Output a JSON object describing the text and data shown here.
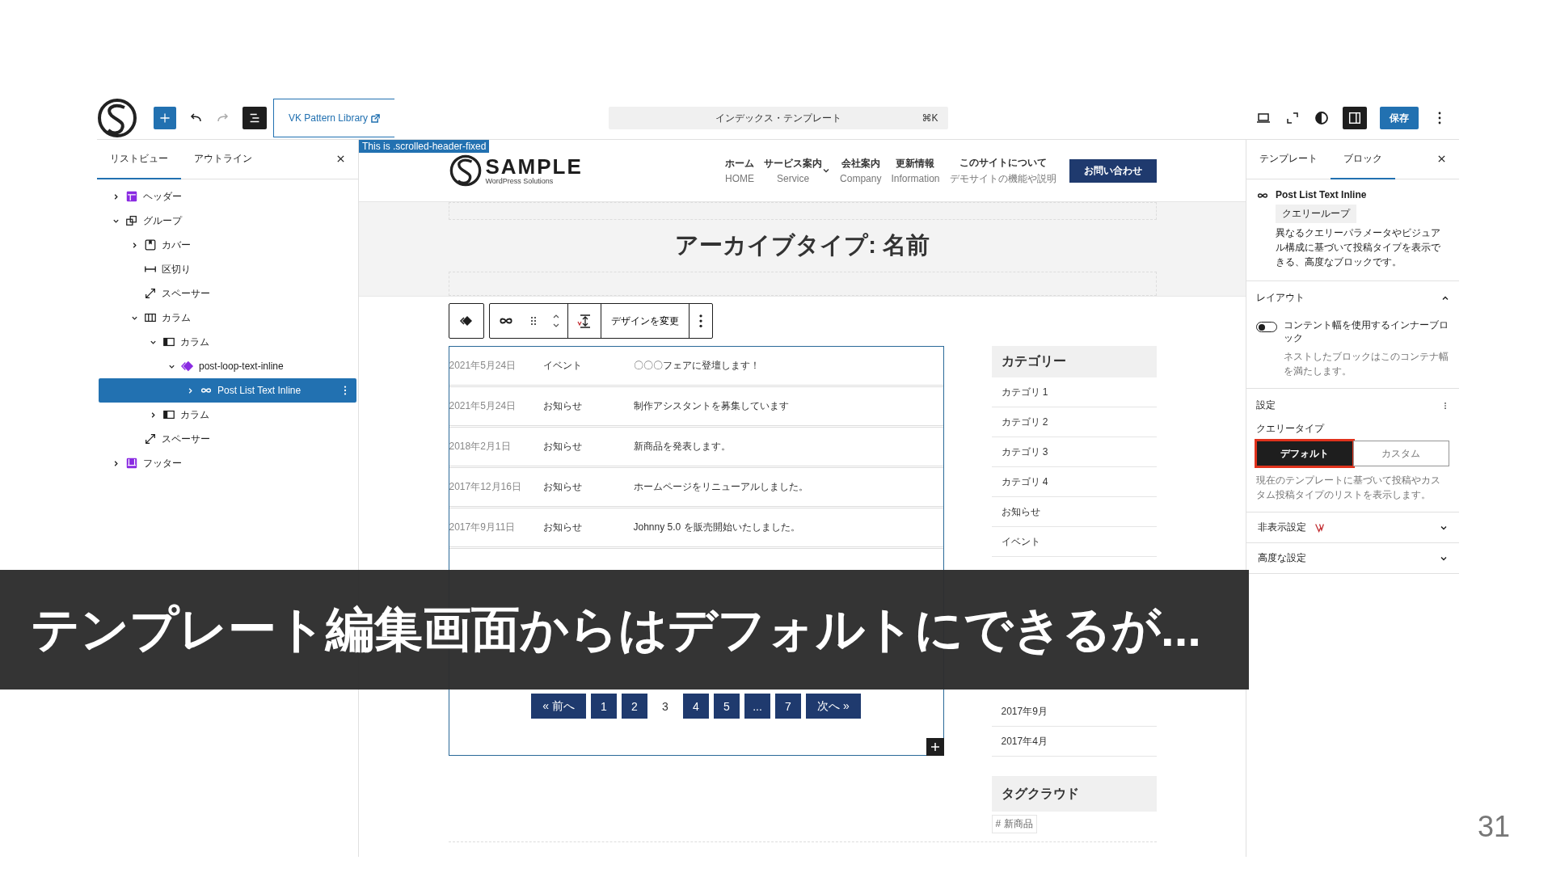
{
  "toolbar": {
    "pattern_link": "VK Pattern Library",
    "command_bar": {
      "title": "インデックス・テンプレート",
      "shortcut": "⌘K"
    },
    "save_button": "保存"
  },
  "left_panel": {
    "tabs": [
      {
        "label": "リストビュー",
        "selected": true
      },
      {
        "label": "アウトライン",
        "selected": false
      }
    ],
    "tree": [
      {
        "label": "ヘッダー",
        "kind": "header",
        "expanded": false,
        "selected": false
      },
      {
        "label": "グループ",
        "kind": "group",
        "expanded": true,
        "selected": false,
        "children": [
          {
            "label": "カバー",
            "kind": "cover",
            "expanded": false,
            "selected": false
          },
          {
            "label": "区切り",
            "kind": "separator",
            "selected": false
          },
          {
            "label": "スペーサー",
            "kind": "spacer",
            "selected": false
          },
          {
            "label": "カラム",
            "kind": "columns",
            "expanded": true,
            "selected": false,
            "children": [
              {
                "label": "カラム",
                "kind": "column",
                "expanded": true,
                "selected": false,
                "children": [
                  {
                    "label": "post-loop-text-inline",
                    "kind": "pattern",
                    "expanded": true,
                    "selected": false,
                    "children": [
                      {
                        "label": "Post List Text Inline",
                        "kind": "loop",
                        "expanded": false,
                        "selected": true
                      }
                    ]
                  }
                ]
              },
              {
                "label": "カラム",
                "kind": "column",
                "expanded": false,
                "selected": false
              }
            ]
          },
          {
            "label": "スペーサー",
            "kind": "spacer",
            "selected": false
          }
        ]
      },
      {
        "label": "フッター",
        "kind": "footer",
        "expanded": false,
        "selected": false
      }
    ]
  },
  "canvas": {
    "label_tag": "This is .scrolled-header-fixed",
    "site": {
      "logo": "SAMPLE",
      "logo_sub": "WordPress Solutions",
      "nav": [
        {
          "label": "ホーム",
          "sub": "HOME",
          "has_dropdown": false
        },
        {
          "label": "サービス案内",
          "sub": "Service",
          "has_dropdown": true
        },
        {
          "label": "会社案内",
          "sub": "Company",
          "has_dropdown": false
        },
        {
          "label": "更新情報",
          "sub": "Information",
          "has_dropdown": false
        },
        {
          "label": "このサイトについて",
          "sub": "デモサイトの機能や説明",
          "has_dropdown": false
        }
      ],
      "contact_button": "お問い合わせ"
    },
    "archive_title": "アーカイブタイプ: 名前",
    "block_toolbar": {
      "design_button": "デザインを変更"
    },
    "posts": [
      {
        "date": "2021年5月24日",
        "category": "イベント",
        "title": "〇〇〇フェアに登壇します！"
      },
      {
        "date": "2021年5月24日",
        "category": "お知らせ",
        "title": "制作アシスタントを募集しています"
      },
      {
        "date": "2018年2月1日",
        "category": "お知らせ",
        "title": "新商品を発表します。"
      },
      {
        "date": "2017年12月16日",
        "category": "お知らせ",
        "title": "ホームページをリニューアルしました。"
      },
      {
        "date": "2017年9月11日",
        "category": "お知らせ",
        "title": "Johnny 5.0 を販売開始いたしました。"
      }
    ],
    "pagination": [
      {
        "label": "« 前へ",
        "selected": false
      },
      {
        "label": "1",
        "selected": false
      },
      {
        "label": "2",
        "selected": false
      },
      {
        "label": "3",
        "selected": true
      },
      {
        "label": "4",
        "selected": false
      },
      {
        "label": "5",
        "selected": false
      },
      {
        "label": "...",
        "selected": false
      },
      {
        "label": "7",
        "selected": false
      },
      {
        "label": "次へ »",
        "selected": false
      }
    ],
    "sidebar": {
      "category_heading": "カテゴリー",
      "categories": [
        "カテゴリ 1",
        "カテゴリ 2",
        "カテゴリ 3",
        "カテゴリ 4",
        "お知らせ",
        "イベント"
      ],
      "archive_items": [
        "2017年9月",
        "2017年4月"
      ],
      "tag_heading": "タグクラウド",
      "tags": [
        "# 新商品"
      ]
    }
  },
  "right_panel": {
    "tabs": [
      {
        "label": "テンプレート",
        "selected": false
      },
      {
        "label": "ブロック",
        "selected": true
      }
    ],
    "block": {
      "name": "Post List Text Inline",
      "badge": "クエリーループ",
      "description": "異なるクエリーパラメータやビジュアル構成に基づいて投稿タイプを表示できる、高度なブロックです。"
    },
    "layout": {
      "title": "レイアウト",
      "expanded": true,
      "toggle": {
        "label": "コンテント幅を使用するインナーブロック",
        "on": false,
        "help": "ネストしたブロックはこのコンテナ幅を満たします。"
      }
    },
    "settings": {
      "title": "設定",
      "query_type_label": "クエリータイプ",
      "options": [
        {
          "label": "デフォルト",
          "selected": true
        },
        {
          "label": "カスタム",
          "selected": false
        }
      ],
      "help": "現在のテンプレートに基づいて投稿やカスタム投稿タイプのリストを表示します。"
    },
    "sections": [
      {
        "title": "非表示設定",
        "kind": "visibility",
        "expanded": false
      },
      {
        "title": "高度な設定",
        "kind": "advanced",
        "expanded": false
      }
    ]
  },
  "caption": "テンプレート編集画面からはデフォルトにできるが...",
  "page_number": "31"
}
